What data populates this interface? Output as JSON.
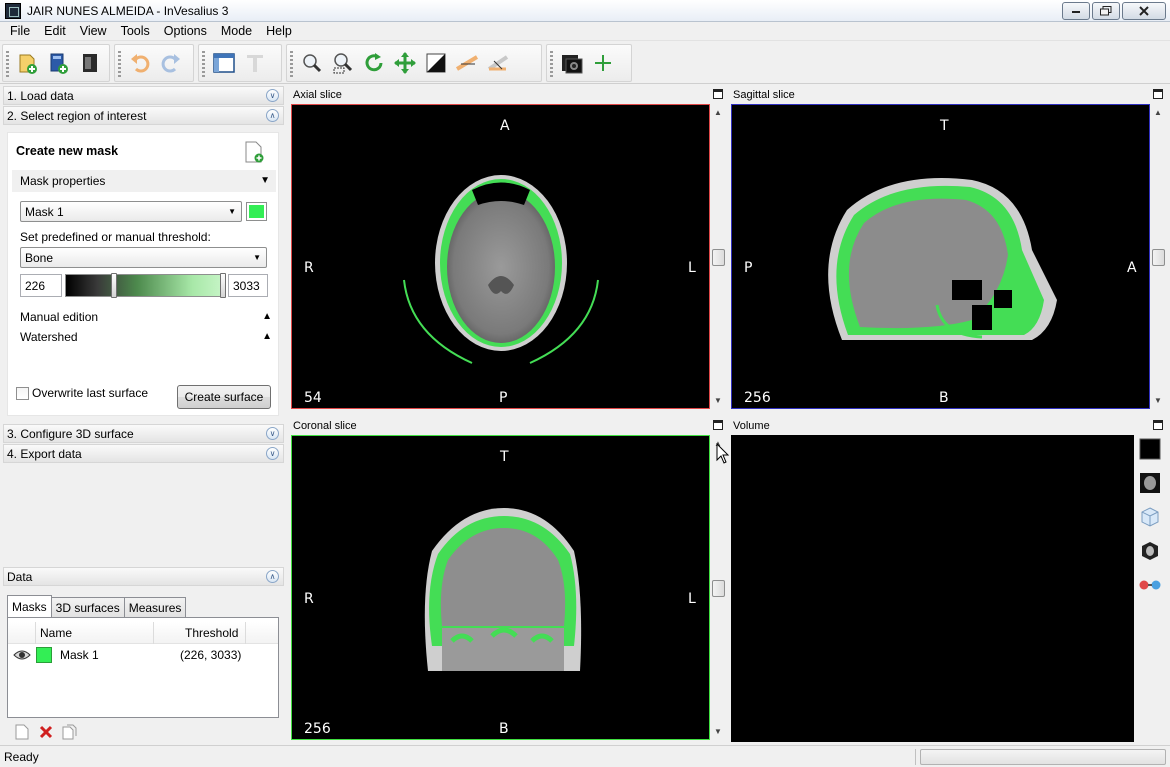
{
  "window": {
    "title": "JAIR NUNES ALMEIDA - InVesalius 3"
  },
  "menu": [
    "File",
    "Edit",
    "View",
    "Tools",
    "Options",
    "Mode",
    "Help"
  ],
  "toolbar": {
    "groups": [
      [
        "import-dicom-icon",
        "import-project-icon",
        "close-project-icon"
      ],
      [
        "undo-icon",
        "redo-icon"
      ],
      [
        "layout-icon",
        "text-icon"
      ],
      [
        "zoom-icon",
        "zoom-region-icon",
        "rotate-icon",
        "pan-icon",
        "contrast-icon",
        "measure-linear-icon",
        "measure-angular-icon"
      ],
      [
        "screenshot-icon",
        "cross-icon"
      ]
    ]
  },
  "left_panel": {
    "sections": [
      "1. Load data",
      "2. Select region of interest",
      "3. Configure 3D surface",
      "4. Export data",
      "Data"
    ],
    "roi": {
      "create_mask_title": "Create new mask",
      "mask_properties_label": "Mask properties",
      "mask_selected": "Mask 1",
      "mask_color": "#33ee55",
      "threshold_label": "Set predefined or manual threshold:",
      "threshold_preset": "Bone",
      "threshold_min": "226",
      "threshold_max": "3033",
      "manual_edition_label": "Manual edition",
      "watershed_label": "Watershed",
      "overwrite_label": "Overwrite last surface",
      "overwrite_checked": false,
      "create_surface_button": "Create surface"
    },
    "data": {
      "tabs": [
        "Masks",
        "3D surfaces",
        "Measures"
      ],
      "active_tab": "Masks",
      "columns": [
        "Name",
        "Threshold"
      ],
      "rows": [
        {
          "visible": true,
          "color": "#33ee55",
          "name": "Mask 1",
          "threshold": "(226, 3033)"
        }
      ]
    }
  },
  "viewports": {
    "axial": {
      "title": "Axial slice",
      "top": "A",
      "bottom": "P",
      "left": "R",
      "right": "L",
      "slice": "54"
    },
    "sagittal": {
      "title": "Sagittal slice",
      "top": "T",
      "bottom": "B",
      "left": "P",
      "right": "A",
      "slice": "256"
    },
    "coronal": {
      "title": "Coronal slice",
      "top": "T",
      "bottom": "B",
      "left": "R",
      "right": "L",
      "slice": "256"
    },
    "volume": {
      "title": "Volume"
    }
  },
  "volume_tools": [
    "background-color-icon",
    "raycasting-icon",
    "view-orientation-icon",
    "stereo-icon",
    "stereo-glasses-icon"
  ],
  "status": {
    "text": "Ready",
    "progress": 0
  },
  "colors": {
    "mask_green": "#33ee55",
    "axial_border": "#e04848",
    "sagittal_border": "#3030c0",
    "coronal_border": "#40e040"
  }
}
